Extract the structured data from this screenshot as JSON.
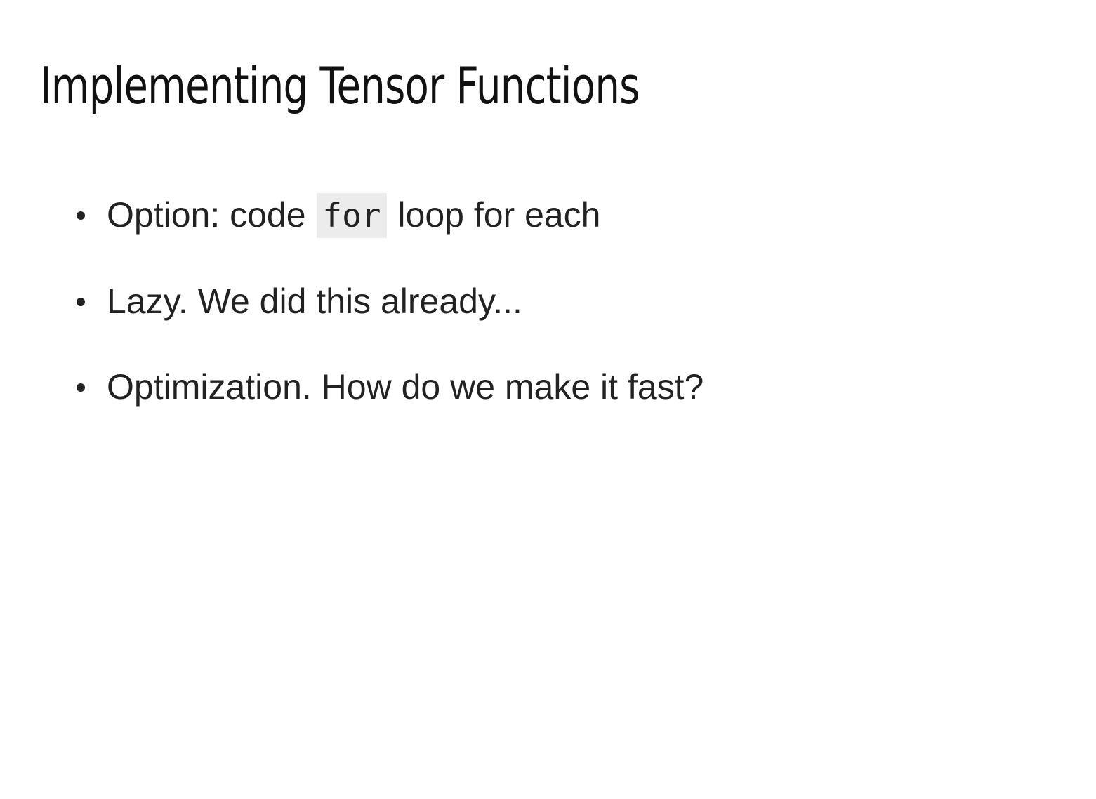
{
  "slide": {
    "title": "Implementing Tensor Functions",
    "bullets": [
      {
        "before_code": "Option: code ",
        "code": "for",
        "after_code": " loop for each"
      },
      {
        "text": "Lazy. We did this already..."
      },
      {
        "text": "Optimization. How do we make it fast?"
      }
    ]
  }
}
